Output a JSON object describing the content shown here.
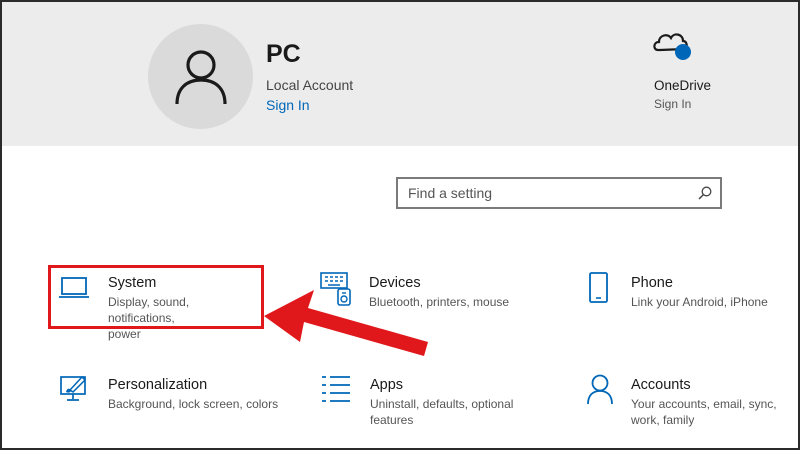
{
  "account": {
    "name": "PC",
    "type": "Local Account",
    "sign_in": "Sign In",
    "icon": "user-icon"
  },
  "onedrive": {
    "title": "OneDrive",
    "status": "Sign In",
    "icon": "onedrive-cloud-icon"
  },
  "search": {
    "placeholder": "Find a setting",
    "icon": "search-icon"
  },
  "tiles": [
    {
      "title": "System",
      "desc_lines": [
        "Display, sound, notifications,",
        "power"
      ],
      "icon": "laptop-icon"
    },
    {
      "title": "Devices",
      "desc_lines": [
        "Bluetooth, printers, mouse"
      ],
      "icon": "devices-icon"
    },
    {
      "title": "Phone",
      "desc_lines": [
        "Link your Android, iPhone"
      ],
      "icon": "phone-icon"
    },
    {
      "title": "Personalization",
      "desc_lines": [
        "Background, lock screen, colors"
      ],
      "icon": "personalization-icon"
    },
    {
      "title": "Apps",
      "desc_lines": [
        "Uninstall, defaults, optional",
        "features"
      ],
      "icon": "apps-icon"
    },
    {
      "title": "Accounts",
      "desc_lines": [
        "Your accounts, email, sync,",
        "work, family"
      ],
      "icon": "accounts-icon"
    }
  ],
  "annotation": {
    "highlight_color": "#e0181b",
    "highlighted_tile": "System"
  },
  "colors": {
    "accent": "#0067b8",
    "header_bg": "#ececec",
    "annotation_red": "#e0181b"
  }
}
